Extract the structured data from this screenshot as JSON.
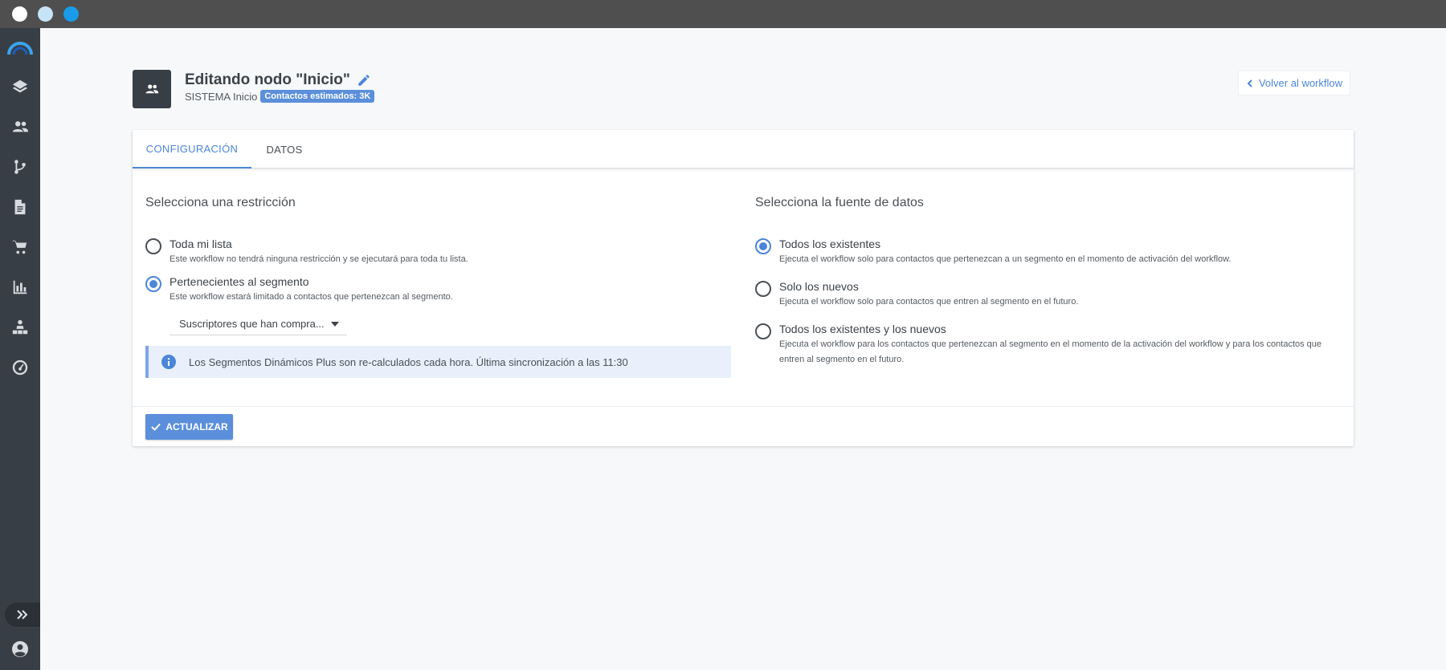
{
  "header": {
    "title": "Editando nodo \"Inicio\"",
    "subtitle_prefix": "SISTEMA Inicio",
    "badge": "Contactos estimados: 3K",
    "back_label": "Volver al workflow"
  },
  "tabs": [
    {
      "label": "CONFIGURACIÓN",
      "active": true
    },
    {
      "label": "DATOS",
      "active": false
    }
  ],
  "restriction": {
    "title": "Selecciona una restricción",
    "options": [
      {
        "label": "Toda mi lista",
        "desc": "Este workflow no tendrá ninguna restricción y se ejecutará para toda tu lista.",
        "checked": false
      },
      {
        "label": "Pertenecientes al segmento",
        "desc": "Este workflow estará limitado a contactos que pertenezcan al segmento.",
        "checked": true
      }
    ],
    "segment_select": "Suscriptores que han compra...",
    "info": "Los Segmentos Dinámicos Plus son re-calculados cada hora. Última sincronización a las 11:30"
  },
  "source": {
    "title": "Selecciona la fuente de datos",
    "options": [
      {
        "label": "Todos los existentes",
        "desc": "Ejecuta el workflow solo para contactos que pertenezcan a un segmento en el momento de activación del workflow.",
        "checked": true
      },
      {
        "label": "Solo los nuevos",
        "desc": "Ejecuta el workflow solo para contactos que entren al segmento en el futuro.",
        "checked": false
      },
      {
        "label": "Todos los existentes y los nuevos",
        "desc": "Ejecuta el workflow para los contactos que pertenezcan al segmento en el momento de la activación del workflow y para los contactos que entren al segmento en el futuro.",
        "checked": false
      }
    ]
  },
  "footer": {
    "update_label": "ACTUALIZAR"
  },
  "colors": {
    "accent": "#4b86d9",
    "sidebar": "#383e45",
    "button": "#5b8fdb"
  },
  "sidebar": {
    "icons": [
      "logo-icon",
      "layers-icon",
      "contacts-icon",
      "workflow-icon",
      "document-icon",
      "cart-icon",
      "chart-icon",
      "sitemap-icon",
      "dashboard-icon",
      "expand-icon",
      "user-icon"
    ]
  }
}
